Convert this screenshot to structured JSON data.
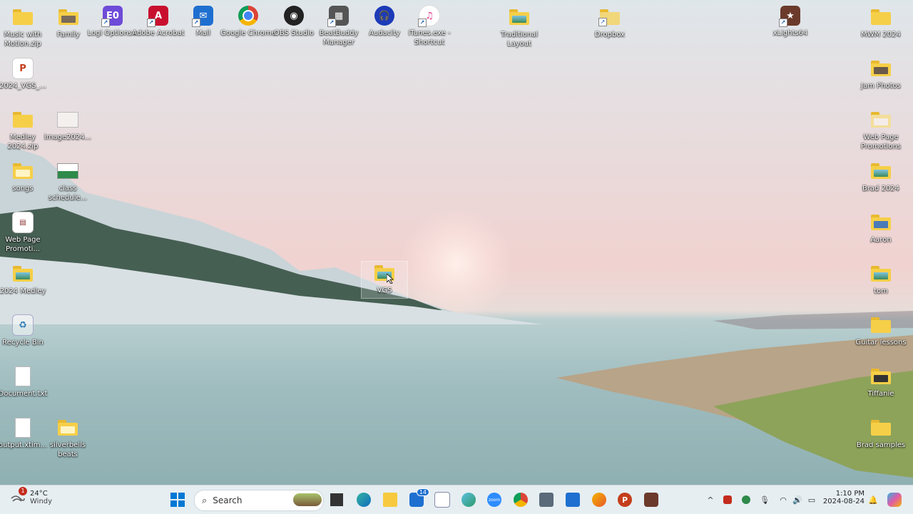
{
  "desktop": {
    "icons_left": [
      {
        "label": "Music with Motion.zip",
        "icon": "zip-folder-icon"
      },
      {
        "label": "Family",
        "icon": "folder-icon"
      },
      {
        "label": "Logi Options+",
        "icon": "logi-options-icon"
      },
      {
        "label": "Adobe Acrobat",
        "icon": "acrobat-icon"
      },
      {
        "label": "Mail",
        "icon": "mail-icon"
      },
      {
        "label": "Google Chrome",
        "icon": "chrome-icon"
      },
      {
        "label": "OBS Studio",
        "icon": "obs-icon"
      },
      {
        "label": "BeatBuddy Manager",
        "icon": "beatbuddy-icon"
      },
      {
        "label": "Audacity",
        "icon": "audacity-icon"
      },
      {
        "label": "iTunes.exe - Shortcut",
        "icon": "itunes-icon"
      },
      {
        "label": "Traditional Layout",
        "icon": "folder-icon"
      },
      {
        "label": "Dropbox",
        "icon": "folder-icon"
      },
      {
        "label": "xLights64",
        "icon": "xlights-icon"
      },
      {
        "label": "MWM 2024",
        "icon": "folder-icon"
      }
    ],
    "col1": [
      {
        "label": "2024_VGS_...",
        "icon": "powerpoint-file-icon"
      },
      {
        "label": "Medley 2024.zip",
        "icon": "zip-folder-icon"
      },
      {
        "label": "songs",
        "icon": "folder-icon"
      },
      {
        "label": "Web Page Promoti...",
        "icon": "image-file-icon"
      },
      {
        "label": "2024 Medley",
        "icon": "folder-icon"
      },
      {
        "label": "Recycle Bin",
        "icon": "recycle-bin-icon"
      },
      {
        "label": "Document.txt",
        "icon": "text-file-icon"
      },
      {
        "label": "output.xtim...",
        "icon": "text-file-icon"
      }
    ],
    "col2": [
      {
        "label": "image2024...",
        "icon": "image-file-icon"
      },
      {
        "label": "class schedule...",
        "icon": "image-file-icon"
      },
      {
        "label": "silverbells beats",
        "icon": "folder-icon"
      }
    ],
    "col_right": [
      {
        "label": "Jam Photos",
        "icon": "folder-icon"
      },
      {
        "label": "Web Page Promotions",
        "icon": "folder-icon"
      },
      {
        "label": "Brad 2024",
        "icon": "folder-icon"
      },
      {
        "label": "Aaron",
        "icon": "folder-icon"
      },
      {
        "label": "tom",
        "icon": "folder-icon"
      },
      {
        "label": "Guitar lessons",
        "icon": "folder-icon"
      },
      {
        "label": "Tiffanie",
        "icon": "folder-icon"
      },
      {
        "label": "Brad samples",
        "icon": "folder-icon"
      }
    ],
    "dragged": {
      "label": "VGS",
      "icon": "folder-icon"
    }
  },
  "taskbar": {
    "weather_temp": "24°C",
    "weather_desc": "Windy",
    "weather_badge": "1",
    "search_placeholder": "Search",
    "mail_badge": "14",
    "zoom_label": "zoom",
    "clock_time": "1:10 PM",
    "clock_date": "2024-08-24"
  },
  "colors": {
    "folder": "#f6cf48",
    "taskbar": "#e6eef2",
    "accent": "#0078d4"
  }
}
